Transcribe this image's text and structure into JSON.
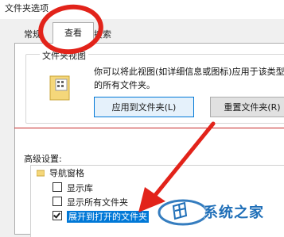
{
  "window": {
    "title": "文件夹选项"
  },
  "tabs": [
    {
      "label": "常规"
    },
    {
      "label": "查看"
    },
    {
      "label": "搜索"
    }
  ],
  "folder_views": {
    "group_title": "文件夹视图",
    "description": "你可以将此视图(如详细信息或图标)应用于该类型的所有文件夹。",
    "apply_button": "应用到文件夹(L)",
    "reset_button": "重置文件夹(R)"
  },
  "advanced": {
    "label": "高级设置:",
    "group": "导航窗格",
    "items": [
      {
        "label": "显示库",
        "checked": false
      },
      {
        "label": "显示所有文件夹",
        "checked": false
      },
      {
        "label": "展开到打开的文件夹",
        "checked": true
      }
    ]
  },
  "watermark": {
    "text": "系统之家"
  },
  "colors": {
    "selection": "#0078d7",
    "annotation_red": "#e2231a"
  }
}
